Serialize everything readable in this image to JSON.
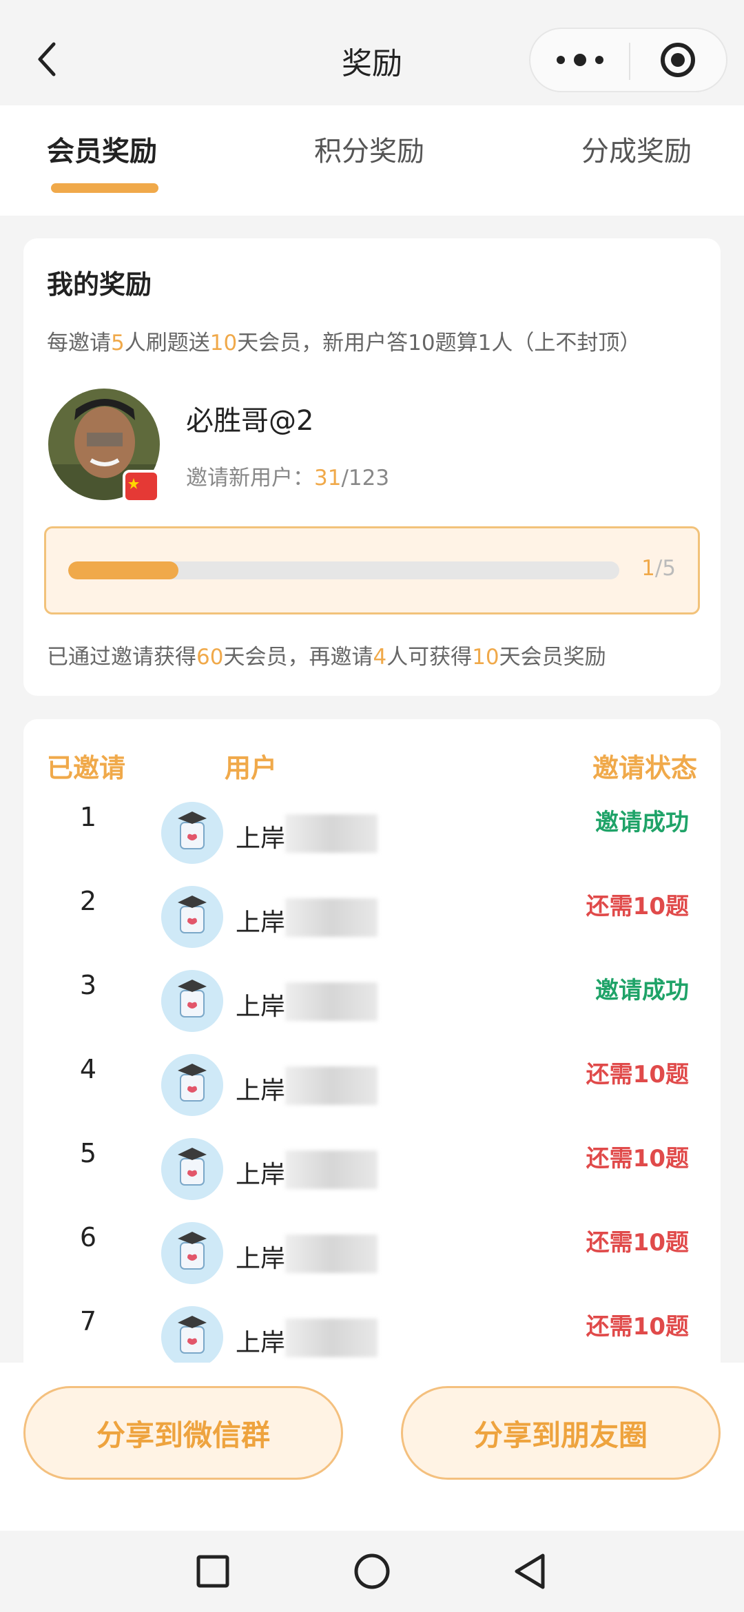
{
  "navbar": {
    "title": "奖励"
  },
  "tabs": [
    {
      "label": "会员奖励"
    },
    {
      "label": "积分奖励"
    },
    {
      "label": "分成奖励"
    }
  ],
  "reward": {
    "title": "我的奖励",
    "rule_parts": [
      "每邀请",
      "5",
      "人刷题送",
      "10",
      "天会员，新用户答10题算1人（上不封顶）"
    ],
    "user_name": "必胜哥@2",
    "invite_label": "邀请新用户：",
    "invite_current": "31",
    "invite_total": "/123",
    "progress": {
      "current": "1",
      "total": "/5",
      "fraction": 0.2
    },
    "earned_parts": [
      "已通过邀请获得",
      "60",
      "天会员，再邀请",
      "4",
      "人可获得",
      "10",
      "天会员奖励"
    ]
  },
  "list": {
    "headers": {
      "invited": "已邀请",
      "user": "用户",
      "status": "邀请状态"
    },
    "rows": [
      {
        "num": "1",
        "name": "上岸",
        "status": "邀请成功"
      },
      {
        "num": "2",
        "name": "上岸",
        "status": "还需10题"
      },
      {
        "num": "3",
        "name": "上岸",
        "status": "邀请成功"
      },
      {
        "num": "4",
        "name": "上岸",
        "status": "还需10题"
      },
      {
        "num": "5",
        "name": "上岸",
        "status": "还需10题"
      },
      {
        "num": "6",
        "name": "上岸",
        "status": "还需10题"
      },
      {
        "num": "7",
        "name": "上岸",
        "status": "还需10题"
      }
    ]
  },
  "share": {
    "wechat_group": "分享到微信群",
    "moments": "分享到朋友圈"
  },
  "colors": {
    "accent": "#f0a94a",
    "success": "#1fa368",
    "pending": "#e04a4a"
  }
}
